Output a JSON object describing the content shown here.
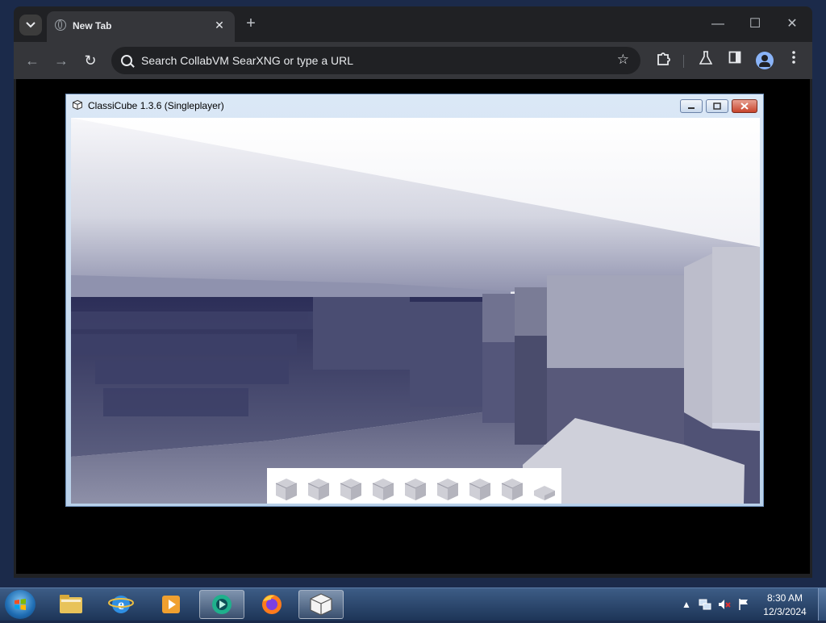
{
  "browser": {
    "tab": {
      "title": "New Tab",
      "close_glyph": "✕"
    },
    "new_tab_glyph": "+",
    "window_controls": {
      "minimize": "—",
      "maximize": "☐",
      "close": "✕"
    },
    "nav": {
      "back": "←",
      "forward": "→",
      "reload": "↻"
    },
    "omnibox": {
      "placeholder": "Search CollabVM SearXNG or type a URL",
      "star_glyph": "☆"
    },
    "toolbar_icons": [
      "extensions-icon",
      "labs-icon",
      "side-panel-icon",
      "profile-icon",
      "menu-icon"
    ]
  },
  "game_window": {
    "title": "ClassiCube 1.3.6 (Singleplayer)",
    "hotbar_slots": 9
  },
  "taskbar": {
    "apps": [
      "windows-explorer",
      "internet-explorer",
      "media-player",
      "collabvm-app",
      "firefox",
      "classicube"
    ],
    "clock_time": "8:30 AM",
    "clock_date": "12/3/2024",
    "tray_expand": "▲"
  }
}
